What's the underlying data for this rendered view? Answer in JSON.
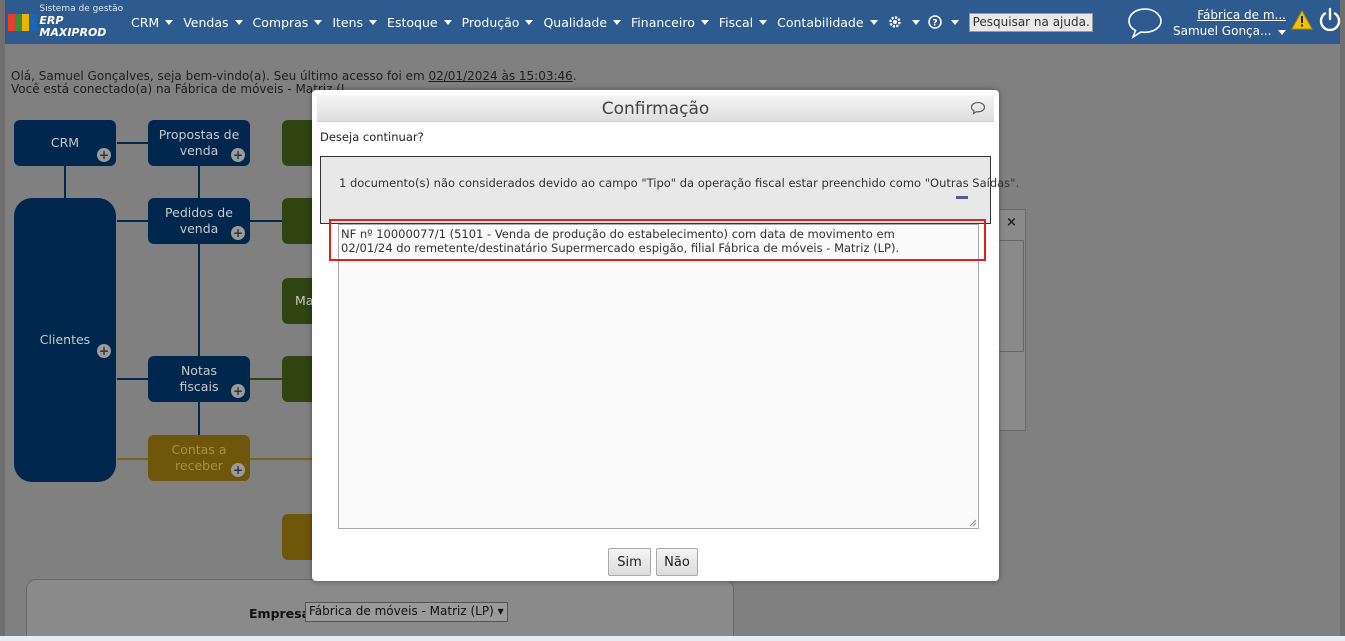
{
  "brand": {
    "line1": "Sistema de gestão",
    "line2": "ERP MAXIPROD",
    "colors": [
      "#e2402b",
      "#3b8d3b",
      "#f0b400",
      "#1e64b4"
    ]
  },
  "menu": {
    "items": [
      "CRM",
      "Vendas",
      "Compras",
      "Itens",
      "Estoque",
      "Produção",
      "Qualidade",
      "Financeiro",
      "Fiscal",
      "Contabilidade"
    ],
    "settings_icon": "gear-icon",
    "help_icon": "question-icon",
    "help_search_placeholder": "Pesquisar na ajuda..."
  },
  "user": {
    "company": "Fábrica de m...",
    "name": "Samuel Gonça..."
  },
  "welcome": {
    "line1_prefix": "Olá, Samuel Gonçalves, seja bem-vindo(a). Seu último acesso foi em ",
    "last_access": "02/01/2024 às 15:03:46",
    "line1_suffix": ".",
    "line2": "Você está conectado(a) na Fábrica de móveis - Matriz (L"
  },
  "flow": {
    "crm": "CRM",
    "proposals": "Propostas de\nvenda",
    "orders": "Pedidos de\nvenda",
    "clients": "Clientes",
    "invoices": "Notas\nfiscais",
    "receivables": "Contas a\nreceber",
    "green_partial": "Ma"
  },
  "form": {
    "company_label": "Empresa",
    "company_value": "Fábrica de móveis - Matriz (LP)"
  },
  "modal": {
    "title": "Confirmação",
    "question": "Deseja continuar?",
    "info": "1 documento(s) não considerados devido ao campo \"Tipo\" da operação fiscal estar preenchido como \"Outras Saídas\".",
    "detail": "NF nº 10000077/1 (5101 - Venda de produção do estabelecimento) com data de movimento em 02/01/24 do remetente/destinatário Supermercado espigão, filial Fábrica de móveis - Matriz (LP).",
    "yes": "Sim",
    "no": "Não"
  },
  "colors": {
    "topbar": "#2d5a8f",
    "highlight": "#e02020"
  }
}
